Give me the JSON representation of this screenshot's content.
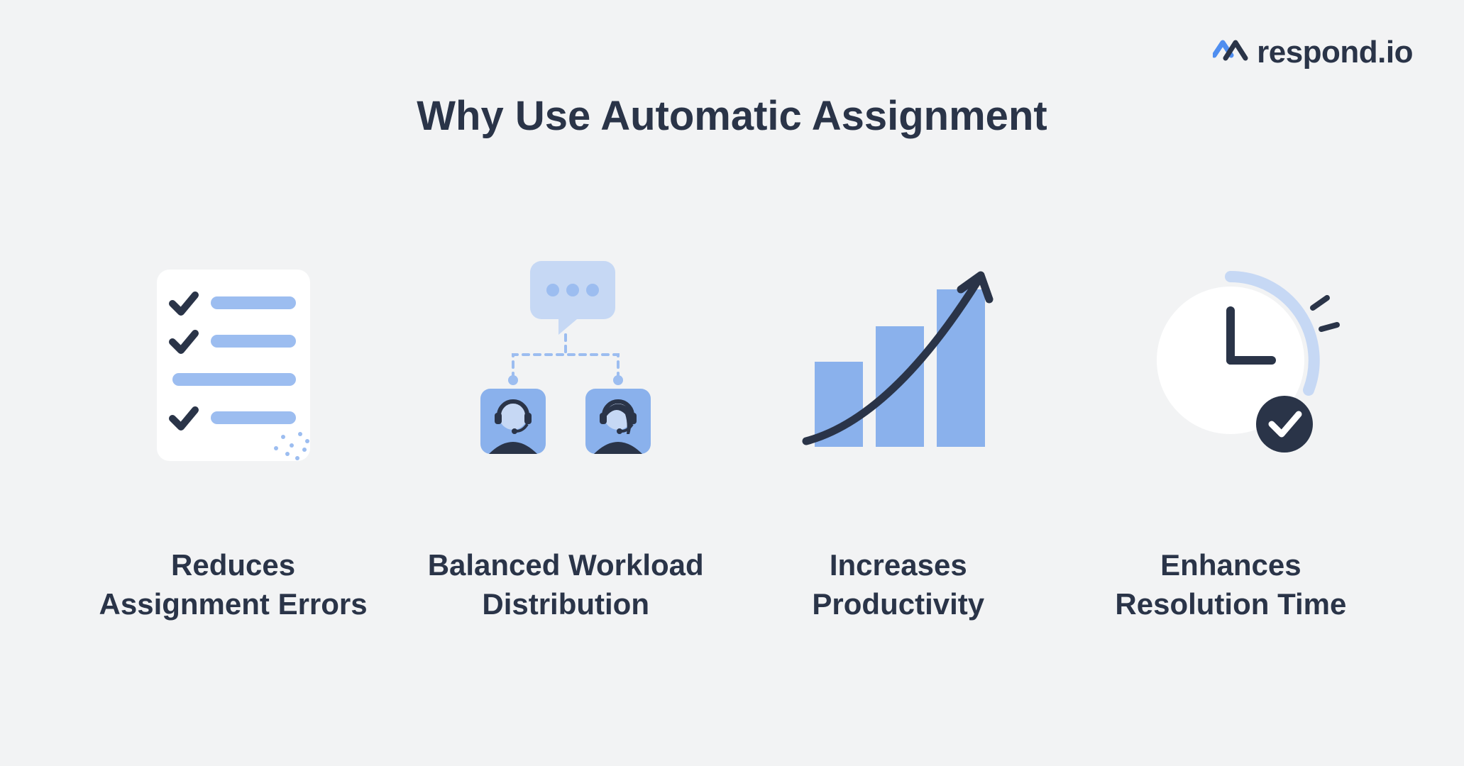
{
  "brand": {
    "name": "respond.io"
  },
  "title": "Why Use Automatic Assignment",
  "features": [
    {
      "icon": "checklist",
      "caption": "Reduces\nAssignment Errors"
    },
    {
      "icon": "distribution",
      "caption": "Balanced Workload\nDistribution"
    },
    {
      "icon": "growth-chart",
      "caption": "Increases\nProductivity"
    },
    {
      "icon": "clock-check",
      "caption": "Enhances\nResolution Time"
    }
  ],
  "colors": {
    "dark": "#2a3448",
    "blue_mid": "#8ab1ec",
    "blue_light": "#c6d8f4",
    "white": "#ffffff",
    "accent": "#4f8ef0"
  }
}
